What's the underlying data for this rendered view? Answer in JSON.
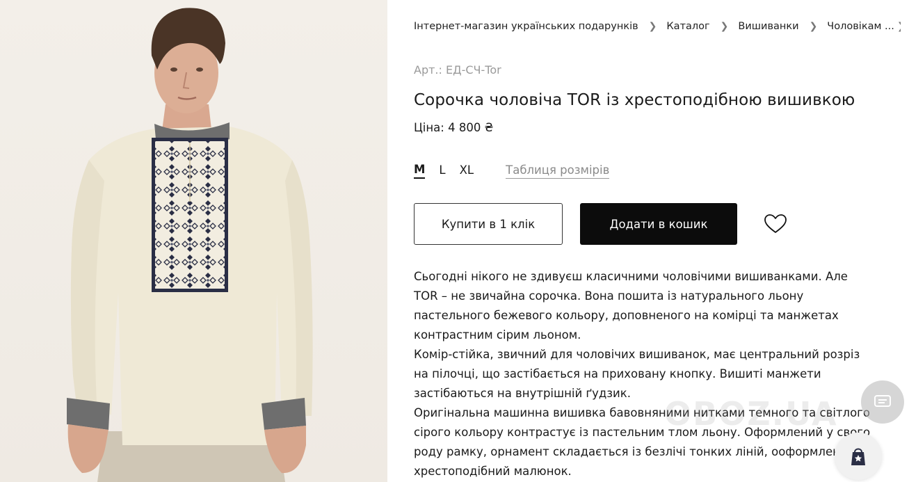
{
  "breadcrumb": [
    {
      "label": "Інтернет-магазин українських подарунків"
    },
    {
      "label": "Каталог"
    },
    {
      "label": "Вишиванки"
    },
    {
      "label": "Чоловікам ..."
    }
  ],
  "product": {
    "sku": "Арт.: ЕД-СЧ-Tor",
    "title": "Сорочка чоловіча TOR із хрестоподібною вишивкою",
    "price": "Ціна: 4 800 ₴"
  },
  "sizes": {
    "options": [
      "M",
      "L",
      "XL"
    ],
    "selected": "M",
    "chart_label": "Таблиця розмірів"
  },
  "actions": {
    "buy_one_click": "Купити в 1 клік",
    "add_to_cart": "Додати в кошик"
  },
  "description": [
    "Сьогодні нікого не здивуєш класичними чоловічими вишиванками. Але",
    "TOR – не звичайна сорочка. Вона пошита із натурального льону",
    "пастельного бежевого кольору, доповненого на комірці та манжетах",
    "контрастним сірим льоном.",
    "Комір-стійка, звичний для чоловічих вишиванок, має центральний розріз",
    "на пілочці, що застібається на приховану кнопку. Вишиті манжети",
    "застібаються на внутрішній ґудзик.",
    "Оригінальна машинна вишивка бавовняними нитками темного та світлого",
    "сірого кольору контрастує із пастельним тлом льону. Оформлений у свого",
    "роду рамку, орнамент складається із безлічі тонких ліній, ооформлених у",
    "хрестоподібний малюнок."
  ],
  "watermark": "OBOZ.UA",
  "icons": {
    "breadcrumb_separator": "chevron-right-icon",
    "wishlist": "heart-icon",
    "chat": "chat-icon",
    "cart": "cart-icon"
  },
  "colors": {
    "primary_button": "#0c0c0c",
    "muted_text": "#9a9a9a",
    "shirt": "#efe9d6",
    "collar_gray": "#6e6e6e",
    "embroidery": "#2a2e45"
  }
}
